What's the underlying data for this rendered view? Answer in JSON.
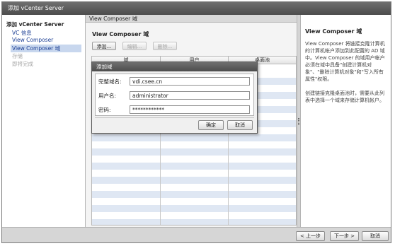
{
  "window": {
    "title": "添加 vCenter Server"
  },
  "nav": {
    "header": "添加 vCenter Server",
    "items": [
      {
        "label": "VC 信息",
        "state": "link"
      },
      {
        "label": "View Composer",
        "state": "link"
      },
      {
        "label": "View Composer 域",
        "state": "selected"
      },
      {
        "label": "存储",
        "state": "disabled"
      },
      {
        "label": "即将完成",
        "state": "disabled"
      }
    ]
  },
  "main": {
    "header": "View Composer 域",
    "section_title": "View Composer 域",
    "toolbar": {
      "add": "添加...",
      "edit": "编辑...",
      "delete": "删除..."
    },
    "table": {
      "columns": [
        "域",
        "用户",
        "桌面池"
      ]
    }
  },
  "help": {
    "title": "View Composer 域",
    "text": "View Composer 将链接克隆计算机的计算机帐户添加到此配置的 AD 域中。View Composer 的域用户帐户必须在域中具备\"创建计算机对象\"、\"删除计算机对象\"和\"写入所有属性\"权限。",
    "text2": "创建链接克隆桌面池时，需要从此列表中选择一个域来存储计算机帐户。"
  },
  "footer": {
    "back": "< 上一步",
    "next": "下一步 >",
    "cancel": "取消"
  },
  "dialog": {
    "title": "添加域",
    "domain_label": "完整域名:",
    "domain_value": "vdi.csee.cn",
    "user_label": "用户名:",
    "user_value": "administrator",
    "password_label": "密码:",
    "password_value": "************",
    "ok": "确定",
    "cancel": "取消"
  }
}
